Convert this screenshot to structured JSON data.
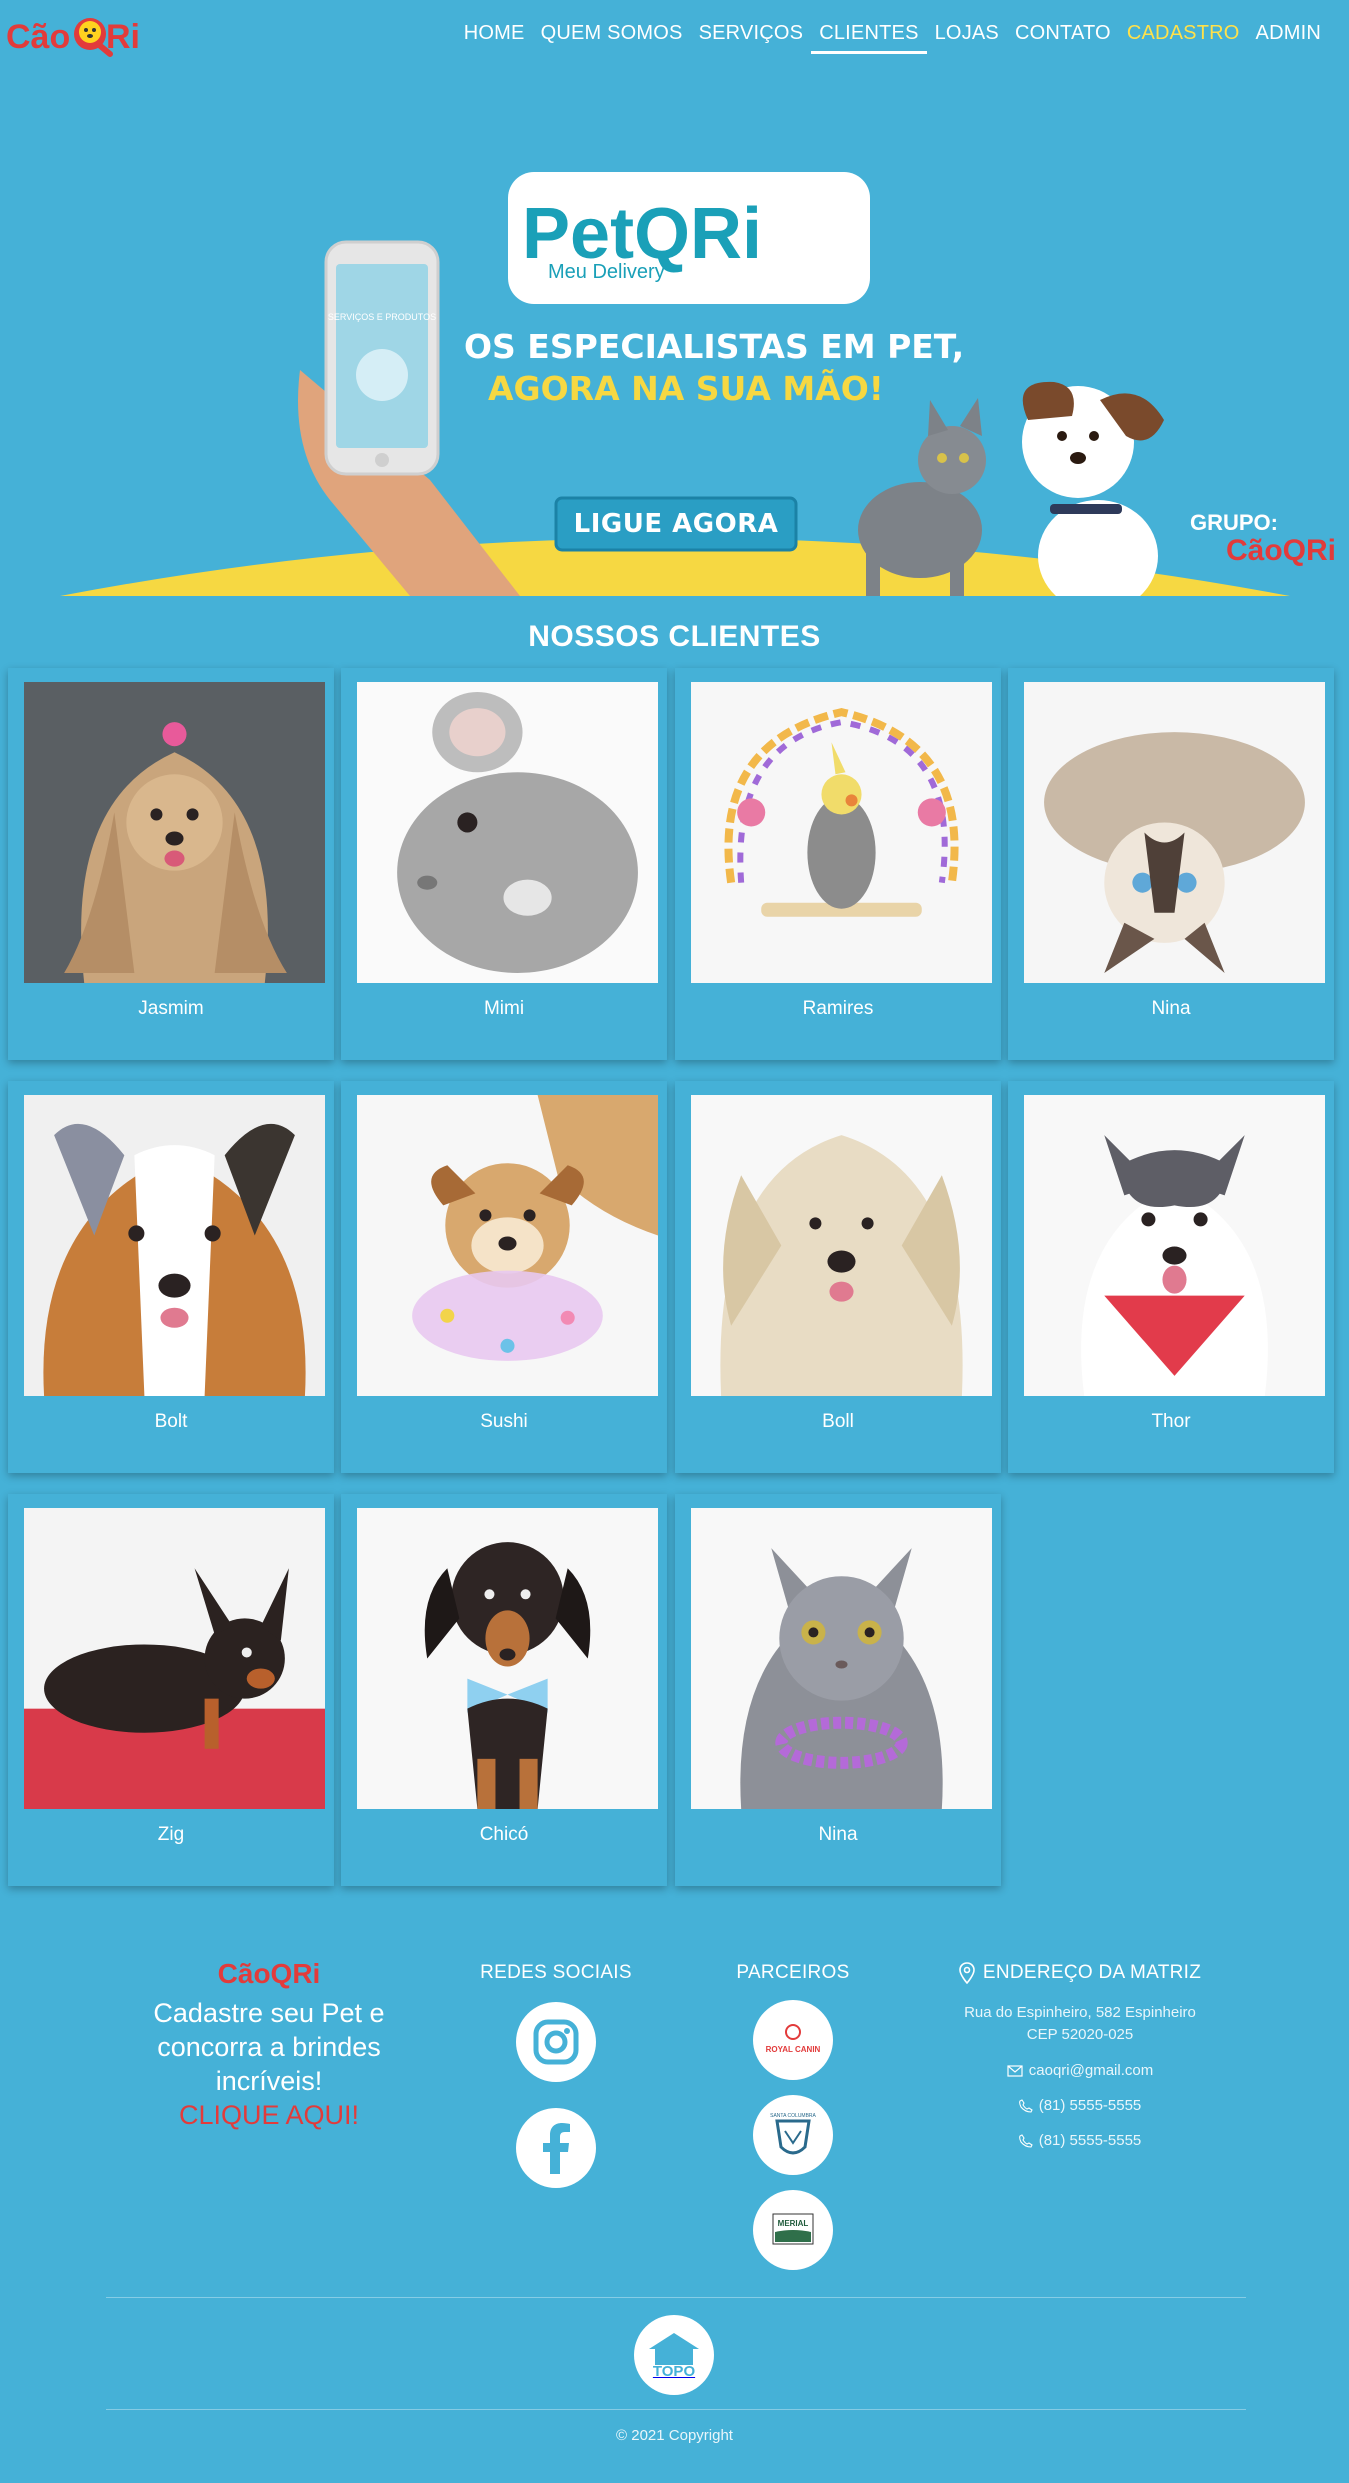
{
  "brand": {
    "logo_text": "CãoQRi"
  },
  "nav": {
    "items": [
      {
        "label": "HOME"
      },
      {
        "label": "QUEM SOMOS"
      },
      {
        "label": "SERVIÇOS"
      },
      {
        "label": "CLIENTES",
        "active": true
      },
      {
        "label": "LOJAS"
      },
      {
        "label": "CONTATO"
      },
      {
        "label": "CADASTRO",
        "highlight": true
      },
      {
        "label": "ADMIN"
      }
    ]
  },
  "hero": {
    "app_name": "PetQRi",
    "app_sub": "Meu Delivery",
    "headline_1": "OS ESPECIALISTAS EM PET,",
    "headline_2": "AGORA NA SUA MÃO!",
    "cta": "LIGUE AGORA",
    "group_label": "GRUPO:",
    "group_brand": "CãoQRi",
    "phone_text": "SERVIÇOS E PRODUTOS"
  },
  "clients": {
    "title": "NOSSOS CLIENTES",
    "items": [
      {
        "name": "Jasmim",
        "kind": "longhair-dog",
        "bg": "#5a5f63",
        "fur": "#c9a57c"
      },
      {
        "name": "Mimi",
        "kind": "chinchilla",
        "bg": "#fafafa",
        "fur": "#a7a7a7"
      },
      {
        "name": "Ramires",
        "kind": "bird",
        "bg": "#f7f7f7",
        "fur": "#8c8c8c"
      },
      {
        "name": "Nina",
        "kind": "cat-upside",
        "bg": "#f6f6f6",
        "fur": "#c9b9a6"
      },
      {
        "name": "Bolt",
        "kind": "sheltie",
        "bg": "#f0f0f0",
        "fur": "#8a8fa0"
      },
      {
        "name": "Sushi",
        "kind": "dog-tutu",
        "bg": "#f7f7f7",
        "fur": "#d8a86e"
      },
      {
        "name": "Boll",
        "kind": "fluffy-dog",
        "bg": "#f8f8f8",
        "fur": "#e8dcc4"
      },
      {
        "name": "Thor",
        "kind": "husky",
        "bg": "#f8f8f8",
        "fur": "#5e5e66"
      },
      {
        "name": "Zig",
        "kind": "pinscher",
        "bg": "#f4f4f4",
        "fur": "#2b2220"
      },
      {
        "name": "Chicó",
        "kind": "dachshund",
        "bg": "#f8f8f8",
        "fur": "#2e2524"
      },
      {
        "name": "Nina",
        "kind": "grey-cat",
        "bg": "#f8f8f8",
        "fur": "#8d9098"
      }
    ]
  },
  "footer": {
    "brand": "CãoQRi",
    "promo": "Cadastre seu Pet e concorra a brindes incríveis!",
    "promo_cta": "CLIQUE AQUI!",
    "social_title": "REDES SOCIAIS",
    "social": [
      "instagram-icon",
      "facebook-icon"
    ],
    "partners_title": "PARCEIROS",
    "partners": [
      {
        "name": "ROYAL CANIN"
      },
      {
        "name": "SANTA COLUMBRA"
      },
      {
        "name": "MERIAL"
      }
    ],
    "address_title": "ENDEREÇO DA MATRIZ",
    "address_line1": "Rua do Espinheiro, 582 Espinheiro",
    "address_line2": "CEP 52020-025",
    "email": "caoqri@gmail.com",
    "phone1": "(81) 5555-5555",
    "phone2": "(81) 5555-5555",
    "top_label": "TOPO",
    "copyright": "© 2021 Copyright"
  },
  "colors": {
    "background": "#45b1d7",
    "accent_yellow": "#ffe14a",
    "accent_red": "#e23b3b",
    "hero_yellow": "#f6d842"
  }
}
